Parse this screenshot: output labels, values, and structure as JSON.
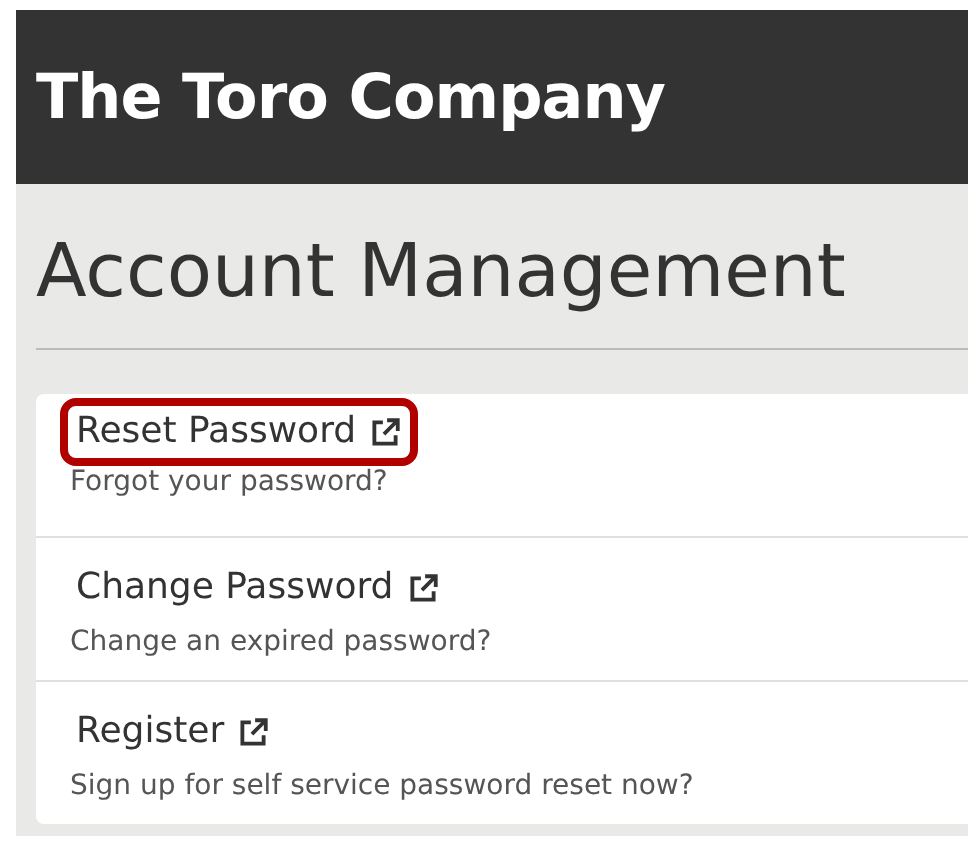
{
  "header": {
    "title": "The Toro Company"
  },
  "page": {
    "title": "Account Management"
  },
  "items": [
    {
      "title": "Reset Password",
      "description": "Forgot your password?",
      "highlighted": true
    },
    {
      "title": "Change Password",
      "description": "Change an expired password?",
      "highlighted": false
    },
    {
      "title": "Register",
      "description": "Sign up for self service password reset now?",
      "highlighted": false
    }
  ]
}
